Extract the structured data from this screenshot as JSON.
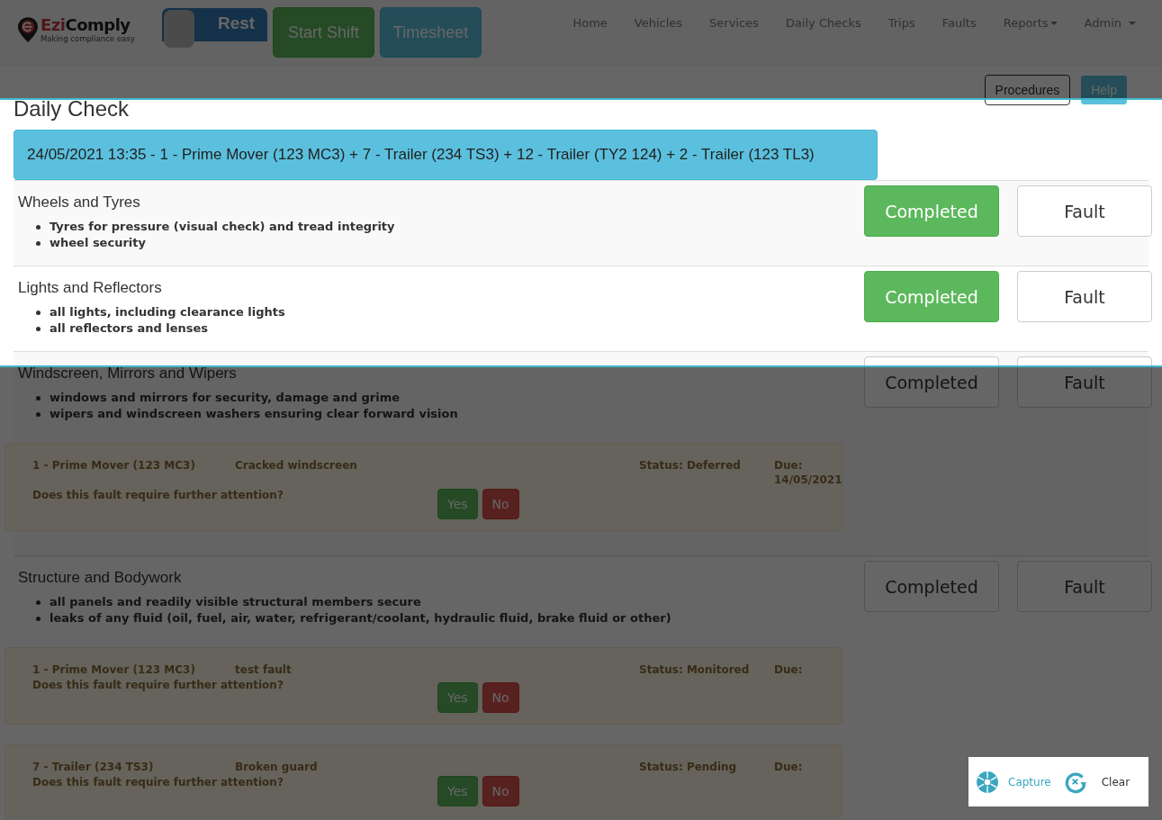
{
  "header": {
    "logo": {
      "brand_part_1": "Ezi",
      "brand_part_2": "Comply",
      "tagline": "Making compliance easy"
    },
    "rest_toggle": {
      "label": "Rest",
      "on": false
    },
    "buttons": [
      {
        "label": "Start Shift",
        "kind": "success"
      },
      {
        "label": "Timesheet",
        "kind": "info"
      }
    ],
    "nav": [
      {
        "label": "Home",
        "dropdown": false
      },
      {
        "label": "Vehicles",
        "dropdown": false
      },
      {
        "label": "Services",
        "dropdown": false
      },
      {
        "label": "Daily Checks",
        "dropdown": false
      },
      {
        "label": "Trips",
        "dropdown": false
      },
      {
        "label": "Faults",
        "dropdown": false
      },
      {
        "label": "Reports",
        "dropdown": true
      },
      {
        "label": "Admin",
        "dropdown": true
      }
    ]
  },
  "actions": [
    {
      "label": "Procedures",
      "kind": "default"
    },
    {
      "label": "Help",
      "kind": "info"
    }
  ],
  "title": "Daily Check",
  "banner": "24/05/2021 13:35 - 1 - Prime Mover (123 MC3) + 7 - Trailer (234 TS3) + 12 - Trailer (TY2 124) + 2 - Trailer (123 TL3)",
  "checks": [
    {
      "name": "Wheels and Tyres",
      "items": [
        "Tyres for pressure (visual check) and tread integrity",
        "wheel security"
      ],
      "completed": true,
      "completed_label": "Completed",
      "fault_label": "Fault"
    },
    {
      "name": "Lights and Reflectors",
      "items": [
        "all lights, including clearance lights",
        "all reflectors and lenses"
      ],
      "completed": true,
      "completed_label": "Completed",
      "fault_label": "Fault"
    },
    {
      "name": "Windscreen, Mirrors and Wipers",
      "items": [
        "windows and mirrors for security, damage and grime",
        "wipers and windscreen washers ensuring clear forward vision"
      ],
      "completed": false,
      "completed_label": "Completed",
      "fault_label": "Fault",
      "faults": [
        {
          "vehicle": "1 - Prime Mover (123 MC3)",
          "description": "Cracked windscreen",
          "status": "Status: Deferred",
          "due_label": "Due:",
          "due": "14/05/2021",
          "question": "Does this fault require further attention?",
          "yes": "Yes",
          "no": "No"
        }
      ]
    },
    {
      "name": "Structure and Bodywork",
      "items": [
        "all panels and readily visible structural members secure",
        "leaks of any fluid (oil, fuel, air, water, refrigerant/coolant, hydraulic fluid, brake fluid or other)"
      ],
      "completed": false,
      "completed_label": "Completed",
      "fault_label": "Fault",
      "faults": [
        {
          "vehicle": "1 - Prime Mover (123 MC3)",
          "description": "test fault",
          "status": "Status: Monitored",
          "due_label": "Due:",
          "question": "Does this fault require further attention?",
          "yes": "Yes",
          "no": "No"
        },
        {
          "vehicle": "7 - Trailer (234 TS3)",
          "description": "Broken guard",
          "status": "Status: Pending",
          "due_label": "Due:",
          "question": "Does this fault require further attention?",
          "yes": "Yes",
          "no": "No"
        }
      ]
    }
  ],
  "capture_toolbar": [
    {
      "label": "Capture",
      "kind": "capture"
    },
    {
      "label": "Clear",
      "kind": "clear"
    }
  ]
}
